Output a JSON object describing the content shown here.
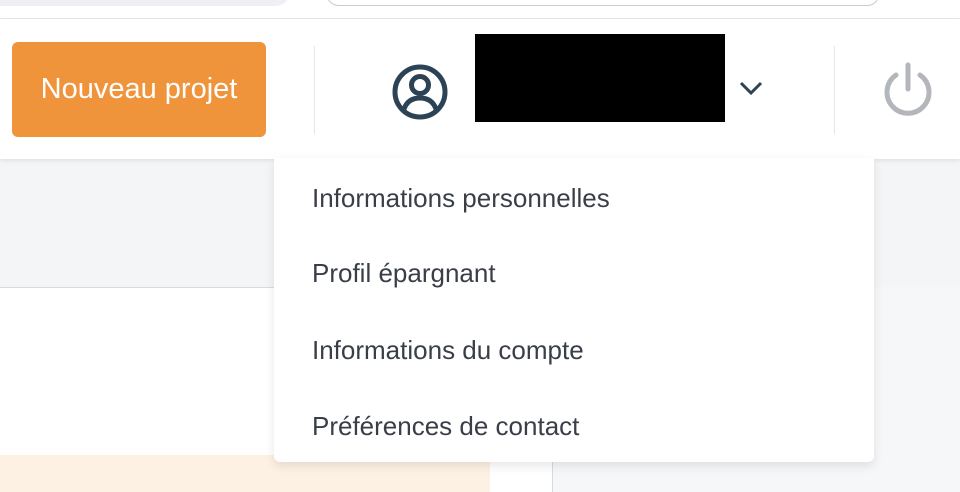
{
  "header": {
    "new_project_label": "Nouveau projet",
    "user_name": "",
    "user_name_redacted": true
  },
  "user_menu": {
    "items": [
      {
        "label": "Informations personnelles"
      },
      {
        "label": "Profil épargnant"
      },
      {
        "label": "Informations du compte"
      },
      {
        "label": "Préférences de contact"
      }
    ]
  },
  "icons": {
    "user": "user-circle-icon",
    "chevron": "chevron-down-icon",
    "power": "power-icon"
  },
  "colors": {
    "accent": "#f0943b",
    "icon_dark": "#2c4356",
    "icon_muted": "#b3b6ba",
    "text": "#3a3f47"
  }
}
